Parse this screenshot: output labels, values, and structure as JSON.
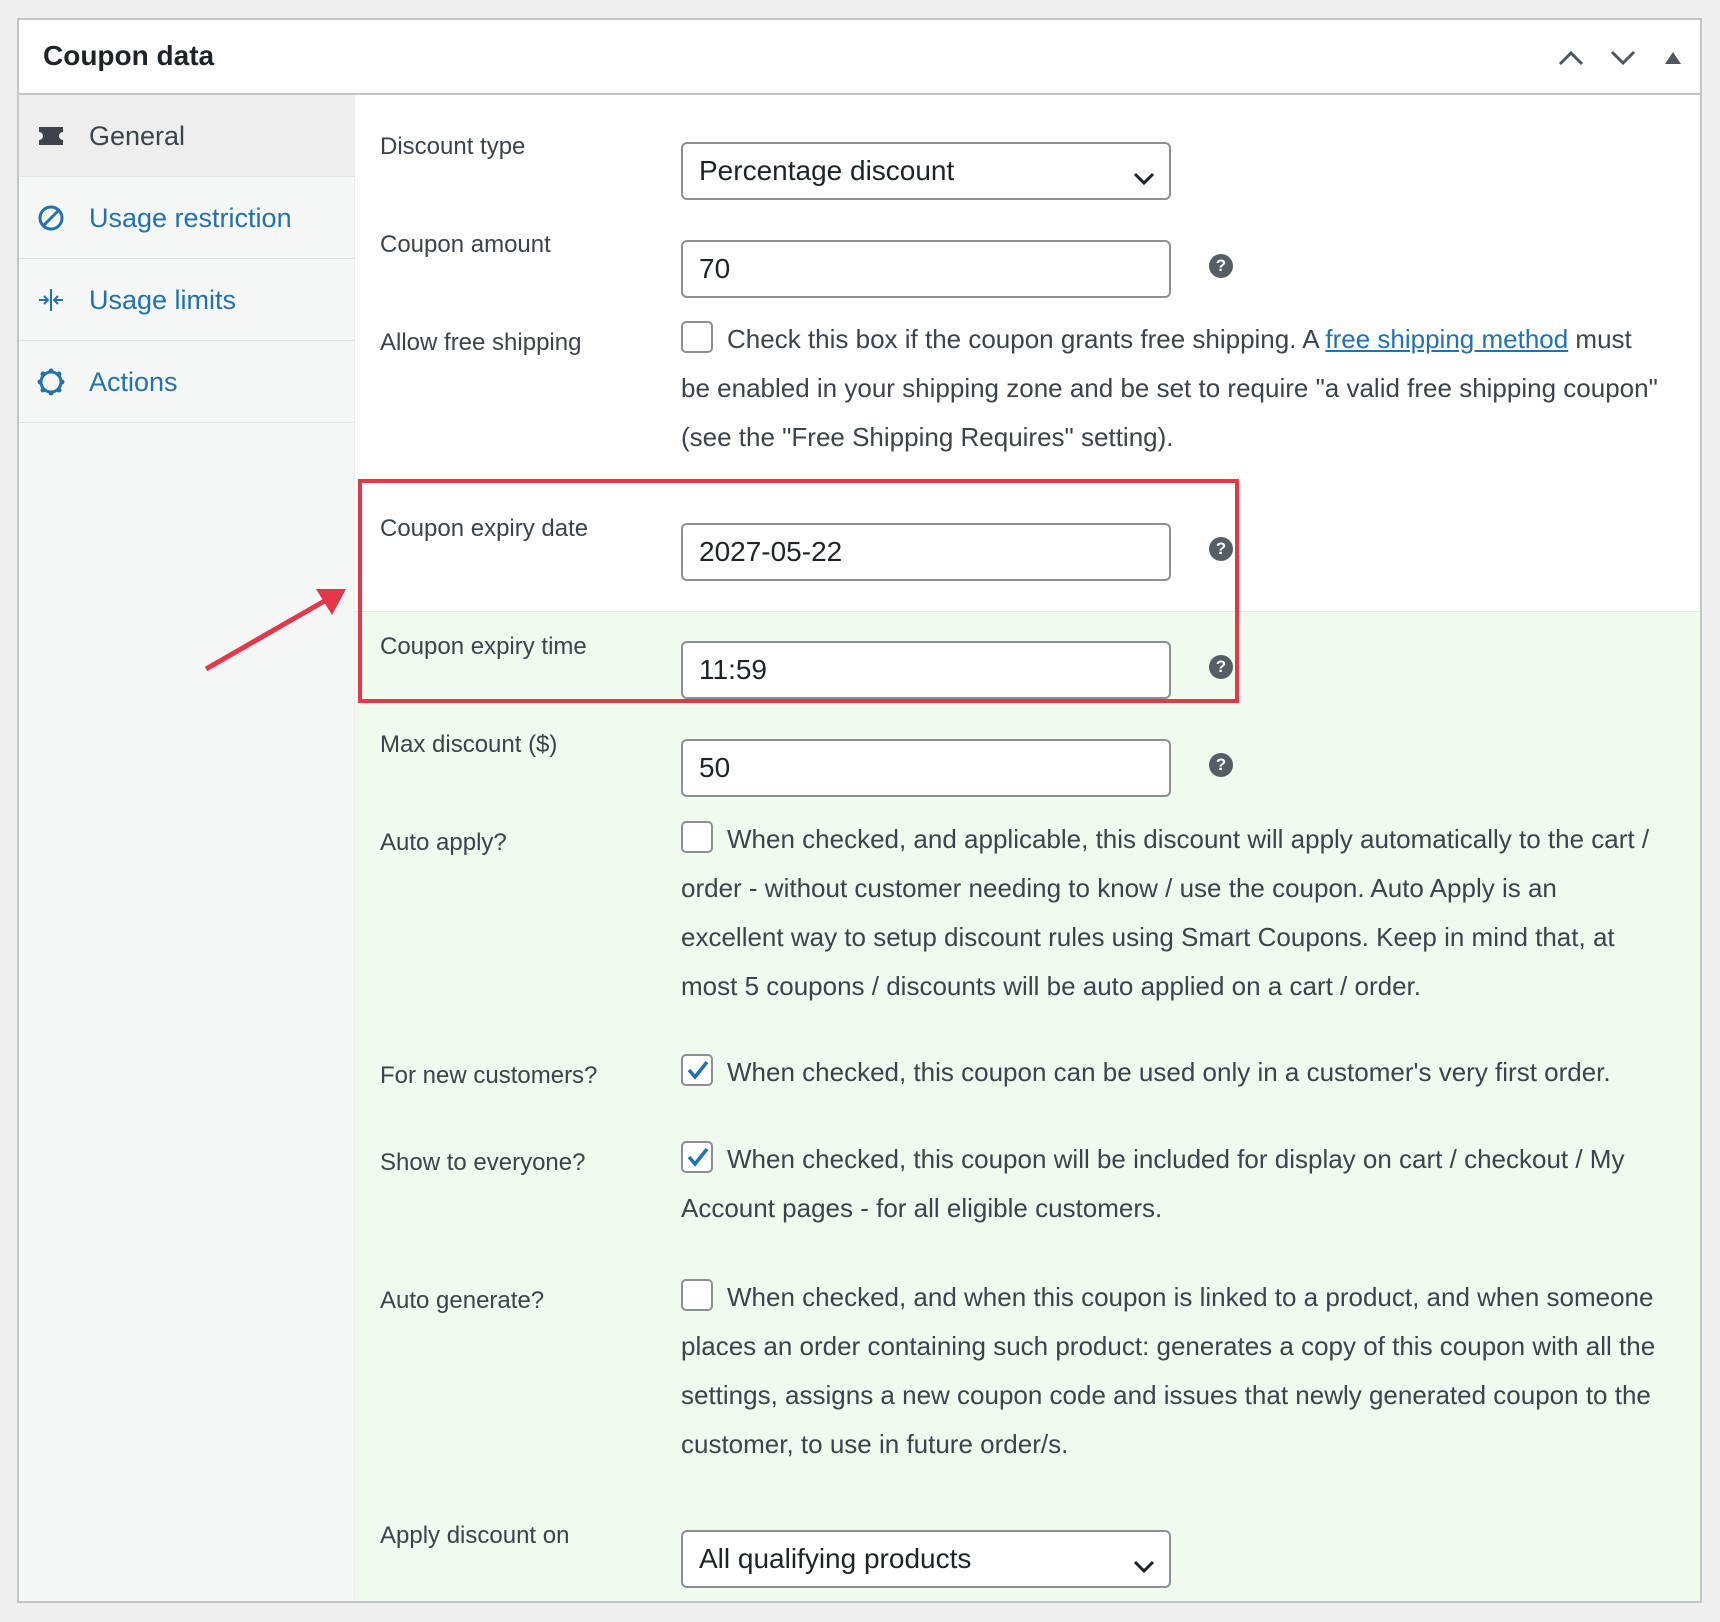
{
  "panel": {
    "title": "Coupon data"
  },
  "header_controls": [
    "move-up-icon",
    "move-down-icon",
    "toggle-panel-icon"
  ],
  "tabs": [
    {
      "label": "General",
      "icon": "ticket-icon",
      "active": true
    },
    {
      "label": "Usage restriction",
      "icon": "no-entry-icon",
      "active": false
    },
    {
      "label": "Usage limits",
      "icon": "arrows-in-icon",
      "active": false
    },
    {
      "label": "Actions",
      "icon": "gear-icon",
      "active": false
    }
  ],
  "fields": {
    "discount_type": {
      "label": "Discount type",
      "value": "Percentage discount"
    },
    "coupon_amount": {
      "label": "Coupon amount",
      "value": "70"
    },
    "free_shipping": {
      "label": "Allow free shipping",
      "checked": false,
      "text_before": "Check this box if the coupon grants free shipping. A ",
      "link": "free shipping method",
      "text_after": " must be enabled in your shipping zone and be set to require \"a valid free shipping coupon\" (see the \"Free Shipping Requires\" setting)."
    },
    "expiry_date": {
      "label": "Coupon expiry date",
      "value": "2027-05-22"
    },
    "expiry_time": {
      "label": "Coupon expiry time",
      "value": "11:59"
    },
    "max_discount": {
      "label": "Max discount ($)",
      "value": "50"
    },
    "auto_apply": {
      "label": "Auto apply?",
      "checked": false,
      "text": "When checked, and applicable, this discount will apply automatically to the cart / order - without customer needing to know / use the coupon. Auto Apply is an excellent way to setup discount rules using Smart Coupons. Keep in mind that, at most 5 coupons / discounts will be auto applied on a cart / order."
    },
    "new_customers": {
      "label": "For new customers?",
      "checked": true,
      "text": "When checked, this coupon can be used only in a customer's very first order."
    },
    "show_everyone": {
      "label": "Show to everyone?",
      "checked": true,
      "text": "When checked, this coupon will be included for display on cart / checkout / My Account pages - for all eligible customers."
    },
    "auto_generate": {
      "label": "Auto generate?",
      "checked": false,
      "text": "When checked, and when this coupon is linked to a product, and when someone places an order containing such product: generates a copy of this coupon with all the settings, assigns a new coupon code and issues that newly generated coupon to the customer, to use in future order/s."
    },
    "apply_discount_on": {
      "label": "Apply discount on",
      "value": "All qualifying products"
    }
  },
  "help_glyph": "?",
  "colors": {
    "accent": "#2271b1",
    "highlight": "#e5374a",
    "green_bg": "#f0faef"
  }
}
